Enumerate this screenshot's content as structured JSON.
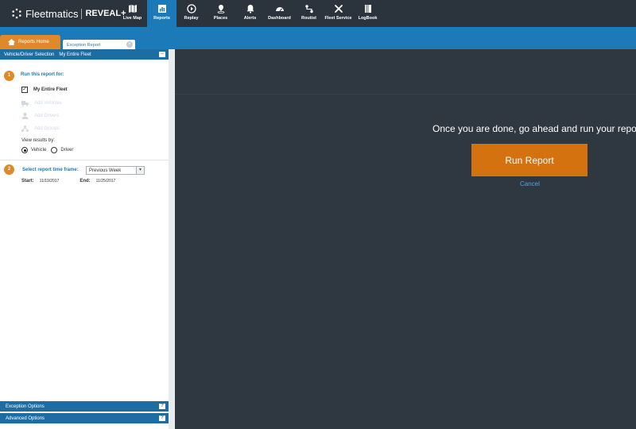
{
  "brand": {
    "name": "Fleetmatics",
    "product": "REVEAL+"
  },
  "nav": [
    {
      "label": "Live Map",
      "icon": "map-icon"
    },
    {
      "label": "Reports",
      "icon": "report-icon",
      "active": true
    },
    {
      "label": "Replay",
      "icon": "replay-icon"
    },
    {
      "label": "Places",
      "icon": "places-icon"
    },
    {
      "label": "Alerts",
      "icon": "bell-icon"
    },
    {
      "label": "Dashboard",
      "icon": "dashboard-icon"
    },
    {
      "label": "Routist",
      "icon": "route-icon"
    },
    {
      "label": "Fleet Service",
      "icon": "wrench-icon"
    },
    {
      "label": "LogBook",
      "icon": "logbook-icon"
    }
  ],
  "tabs": {
    "home": "Reports Home",
    "current": "Exception Report"
  },
  "selection": {
    "label": "Vehicle/Driver Selection",
    "value": "My Entire Fleet"
  },
  "step1": {
    "number": "1",
    "title": "Run this report for:",
    "fleet": "My Entire Fleet",
    "add_vehicles": "Add Vehicles",
    "add_drivers": "Add Drivers",
    "add_groups": "Add Groups",
    "view_by": "View results by:",
    "vehicle": "Vehicle",
    "driver": "Driver"
  },
  "step2": {
    "number": "2",
    "title": "Select report time frame:",
    "timeframe": "Previous Week",
    "start_label": "Start:",
    "start": "11/19/2017",
    "end_label": "End:",
    "end": "11/25/2017"
  },
  "bottom": {
    "exception": "Exception Options",
    "advanced": "Advanced Options",
    "help": "?"
  },
  "main": {
    "prompt": "Once you are done, go ahead and run your report",
    "run": "Run Report",
    "cancel": "Cancel"
  },
  "colors": {
    "accent": "#1c7ab8",
    "orange": "#d4720f",
    "dark": "#2f3740"
  }
}
